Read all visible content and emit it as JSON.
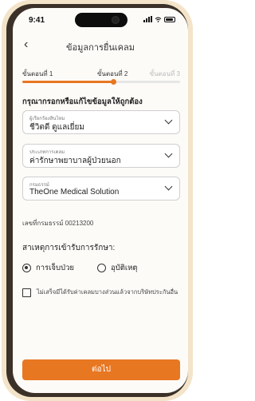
{
  "status_bar": {
    "time": "9:41"
  },
  "nav": {
    "back_glyph": "‹",
    "title": "ข้อมูลการยื่นเคลม"
  },
  "steps": [
    {
      "label": "ขั้นตอนที่ 1",
      "state": "done"
    },
    {
      "label": "ขั้นตอนที่ 2",
      "state": "current"
    },
    {
      "label": "ขั้นตอนที่ 3",
      "state": "upcoming"
    }
  ],
  "progress": {
    "fraction": 0.58
  },
  "heading": "กรุณากรอกหรือแก้ไขข้อมูลให้ถูกต้อง",
  "fields": {
    "insured": {
      "label": "ผู้เรียกร้องสินไหม",
      "value": "ชีวิตดี ดูแลเยี่ยม"
    },
    "claim_type": {
      "label": "ประเภทการเคลม",
      "value": "ค่ารักษาพยาบาลผู้ป่วยนอก"
    },
    "policy": {
      "label": "กรมธรรม์",
      "value": "TheOne Medical Solution"
    }
  },
  "policy_number": "เลขที่กรมธรรม์ 00213200",
  "reason": {
    "title": "สาเหตุการเข้ารับการรักษา:",
    "options": [
      {
        "label": "การเจ็บป่วย",
        "selected": true
      },
      {
        "label": "อุบัติเหตุ",
        "selected": false
      }
    ]
  },
  "other_insurance": {
    "label": "ไม่เสร็จมีได้รับค่าเคลมบางส่วนแล้วจากบริษัทประกันอื่น",
    "checked": false
  },
  "cta": {
    "label": "ต่อไป"
  },
  "colors": {
    "accent": "#e87722",
    "bezel": "#f3e4c9"
  }
}
